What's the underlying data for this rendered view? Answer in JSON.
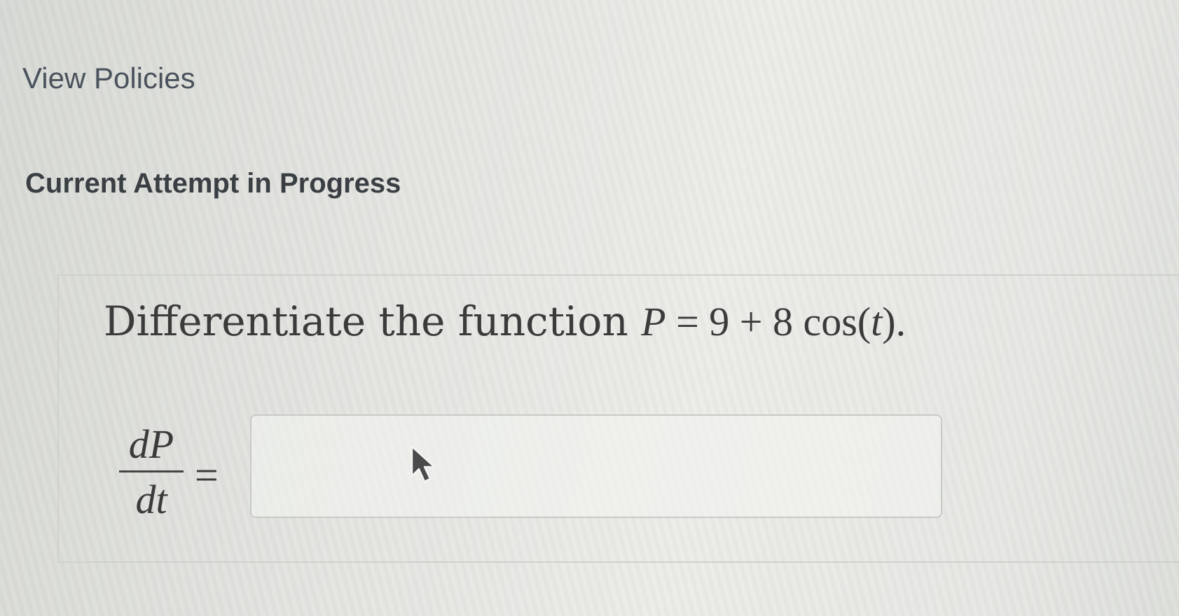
{
  "header": {
    "view_policies_label": "View Policies",
    "attempt_heading": "Current Attempt in Progress"
  },
  "question": {
    "prompt_text": "Differentiate the function",
    "function_var": "P",
    "function_rhs": " = 9 + 8 cos(",
    "function_arg": "t",
    "function_end": ").",
    "answer_label_numerator": "dP",
    "answer_label_denominator": "dt",
    "answer_equals": "=",
    "answer_value": ""
  },
  "icons": {
    "mouse_cursor": "arrow-pointer-icon"
  }
}
